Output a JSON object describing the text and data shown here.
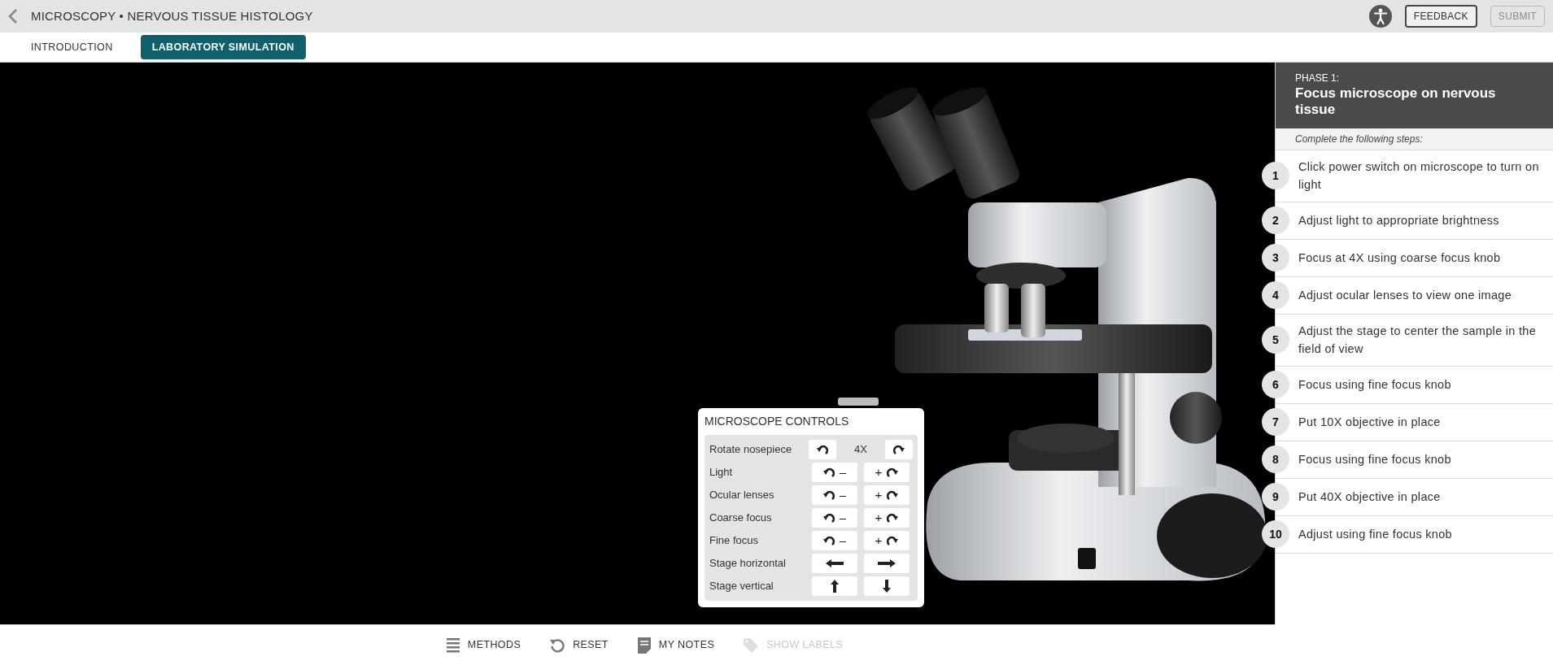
{
  "header": {
    "title": "MICROSCOPY • NERVOUS TISSUE HISTOLOGY",
    "buttons": [
      {
        "label": "FEEDBACK",
        "disabled": false
      },
      {
        "label": "SUBMIT",
        "disabled": true
      }
    ]
  },
  "tabs": [
    {
      "label": "INTRODUCTION",
      "selected": false
    },
    {
      "label": "LABORATORY SIMULATION",
      "selected": true
    }
  ],
  "controls": {
    "title": "MICROSCOPE CONTROLS",
    "rows": [
      {
        "label": "Rotate nosepiece",
        "kind": "rotate",
        "value": "4X"
      },
      {
        "label": "Light",
        "kind": "adjust",
        "decrease": "–",
        "increase": "+"
      },
      {
        "label": "Ocular lenses",
        "kind": "adjust",
        "decrease": "–",
        "increase": "+"
      },
      {
        "label": "Coarse focus",
        "kind": "adjust",
        "decrease": "–",
        "increase": "+"
      },
      {
        "label": "Fine focus",
        "kind": "adjust",
        "decrease": "–",
        "increase": "+"
      },
      {
        "label": "Stage horizontal",
        "kind": "horizontal"
      },
      {
        "label": "Stage vertical",
        "kind": "vertical"
      }
    ]
  },
  "phase": {
    "label": "PHASE 1:",
    "title": "Focus microscope on nervous tissue",
    "instruction": "Complete the following steps:",
    "steps": [
      {
        "number": "1",
        "text": "Click power switch on microscope to turn on light"
      },
      {
        "number": "2",
        "text": "Adjust light to appropriate brightness"
      },
      {
        "number": "3",
        "text": "Focus at 4X using coarse focus knob"
      },
      {
        "number": "4",
        "text": "Adjust ocular lenses to view one image"
      },
      {
        "number": "5",
        "text": "Adjust the stage to center the sample in the field of view"
      },
      {
        "number": "6",
        "text": "Focus using fine focus knob"
      },
      {
        "number": "7",
        "text": "Put 10X objective in place"
      },
      {
        "number": "8",
        "text": "Focus using fine focus knob"
      },
      {
        "number": "9",
        "text": "Put 40X objective in place"
      },
      {
        "number": "10",
        "text": "Adjust using fine focus knob"
      }
    ]
  },
  "toolbar": [
    {
      "label": "METHODS",
      "kind": "lines",
      "disabled": false
    },
    {
      "label": "RESET",
      "kind": "reset",
      "disabled": false
    },
    {
      "label": "MY NOTES",
      "kind": "note",
      "disabled": false
    },
    {
      "label": "SHOW LABELS",
      "kind": "tag",
      "disabled": true
    }
  ]
}
